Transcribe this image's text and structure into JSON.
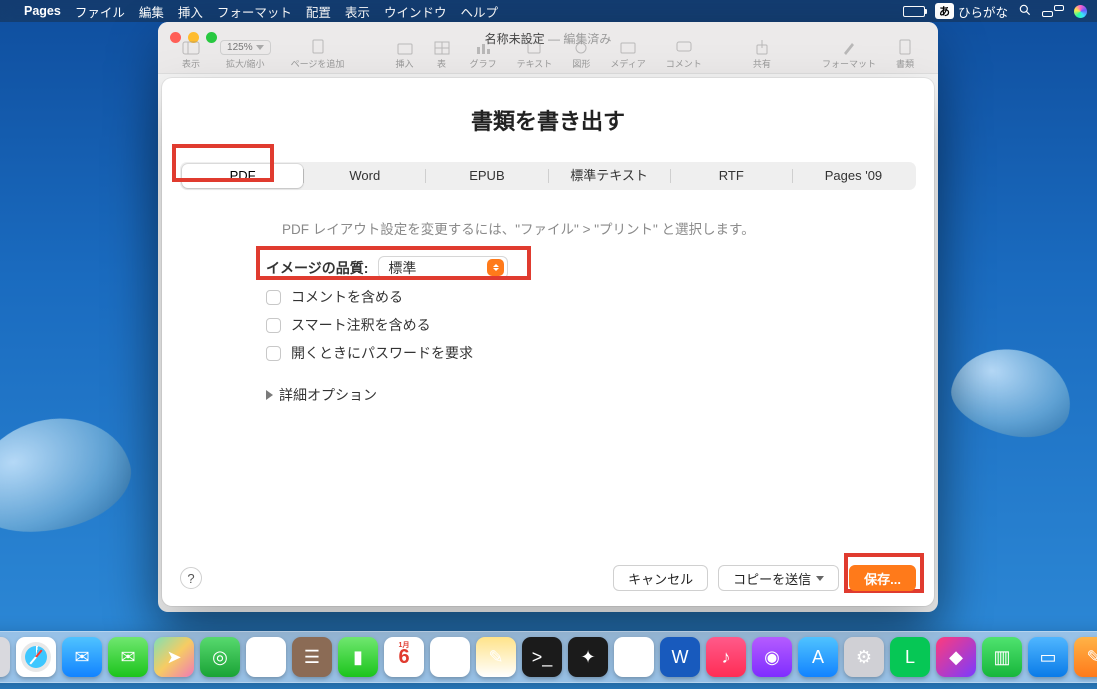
{
  "menubar": {
    "app": "Pages",
    "items": [
      "ファイル",
      "編集",
      "挿入",
      "フォーマット",
      "配置",
      "表示",
      "ウインドウ",
      "ヘルプ"
    ],
    "ime_badge": "あ",
    "ime_label": "ひらがな"
  },
  "window": {
    "title": "名称未設定",
    "subtitle": "— 編集済み",
    "zoom": "125%",
    "toolbar": [
      "表示",
      "拡大/縮小",
      "ページを追加",
      "挿入",
      "表",
      "グラフ",
      "テキスト",
      "図形",
      "メディア",
      "コメント",
      "共有",
      "フォーマット",
      "書類"
    ]
  },
  "sheet": {
    "title": "書類を書き出す",
    "tabs": [
      "PDF",
      "Word",
      "EPUB",
      "標準テキスト",
      "RTF",
      "Pages '09"
    ],
    "active_tab_index": 0,
    "hint": "PDF レイアウト設定を変更するには、\"ファイル\" > \"プリント\" と選択します。",
    "quality_label": "イメージの品質:",
    "quality_value": "標準",
    "check_comments": "コメントを含める",
    "check_annotations": "スマート注釈を含める",
    "check_password": "開くときにパスワードを要求",
    "advanced": "詳細オプション",
    "cancel": "キャンセル",
    "sendcopy": "コピーを送信",
    "save": "保存...",
    "help": "?"
  },
  "dock": [
    {
      "name": "finder",
      "bg": "linear-gradient(180deg,#3ec7ff,#0a7be8)",
      "glyph": "☺"
    },
    {
      "name": "launchpad",
      "bg": "#d9d9de",
      "glyph": "▦"
    },
    {
      "name": "safari",
      "bg": "#fff",
      "glyph": "✱"
    },
    {
      "name": "mail",
      "bg": "linear-gradient(180deg,#4fc3ff,#1283ff)",
      "glyph": "✉"
    },
    {
      "name": "messages",
      "bg": "linear-gradient(180deg,#6fe76f,#1cc41c)",
      "glyph": "✉"
    },
    {
      "name": "maps",
      "bg": "linear-gradient(135deg,#7fe0b5,#f6cc63,#f07ab5)",
      "glyph": "➤"
    },
    {
      "name": "findmy",
      "bg": "linear-gradient(180deg,#57d96e,#1aa336)",
      "glyph": "◎"
    },
    {
      "name": "photos",
      "bg": "#fff",
      "glyph": "✿"
    },
    {
      "name": "contacts",
      "bg": "#8b6b55",
      "glyph": "☰"
    },
    {
      "name": "facetime",
      "bg": "linear-gradient(180deg,#6fe76f,#1cc41c)",
      "glyph": "▮"
    },
    {
      "name": "calendar",
      "bg": "#fff",
      "glyph": "6"
    },
    {
      "name": "reminders",
      "bg": "#fff",
      "glyph": "☰"
    },
    {
      "name": "notes",
      "bg": "linear-gradient(180deg,#ffe38a,#fff)",
      "glyph": "✎"
    },
    {
      "name": "terminal",
      "bg": "#1b1b1b",
      "glyph": ">_"
    },
    {
      "name": "stocks",
      "bg": "#1b1b1b",
      "glyph": "✦"
    },
    {
      "name": "chrome",
      "bg": "#fff",
      "glyph": "◉"
    },
    {
      "name": "word",
      "bg": "#185abd",
      "glyph": "W"
    },
    {
      "name": "music",
      "bg": "linear-gradient(180deg,#ff5a8a,#ff2d55)",
      "glyph": "♪"
    },
    {
      "name": "podcasts",
      "bg": "linear-gradient(180deg,#b55cff,#7f2dff)",
      "glyph": "◉"
    },
    {
      "name": "appstore",
      "bg": "linear-gradient(180deg,#4fc3ff,#1283ff)",
      "glyph": "A"
    },
    {
      "name": "settings",
      "bg": "#d0d0d5",
      "glyph": "⚙"
    },
    {
      "name": "line",
      "bg": "#06c755",
      "glyph": "L"
    },
    {
      "name": "shortcuts",
      "bg": "linear-gradient(135deg,#ff3b7b,#7a3bff)",
      "glyph": "◆"
    },
    {
      "name": "numbers",
      "bg": "linear-gradient(180deg,#4fe36f,#17b63b)",
      "glyph": "▥"
    },
    {
      "name": "keynote",
      "bg": "linear-gradient(180deg,#4fb6ff,#0a7be8)",
      "glyph": "▭"
    },
    {
      "name": "pages",
      "bg": "linear-gradient(180deg,#ffb347,#ff7a1a)",
      "glyph": "✎"
    }
  ]
}
